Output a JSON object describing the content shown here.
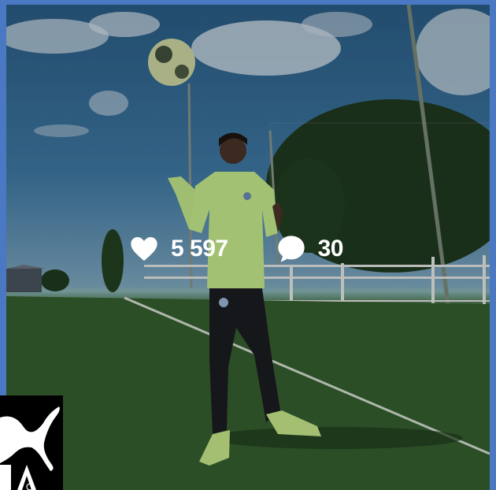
{
  "post": {
    "likes": "5 597",
    "comments": "30",
    "icons": {
      "like": "heart-icon",
      "comment": "comment-bubble-icon"
    }
  },
  "overlay": {
    "logo": "PUMA"
  },
  "colors": {
    "frame": "#4a78c2",
    "logo_bg": "#000000",
    "text": "#ffffff"
  }
}
